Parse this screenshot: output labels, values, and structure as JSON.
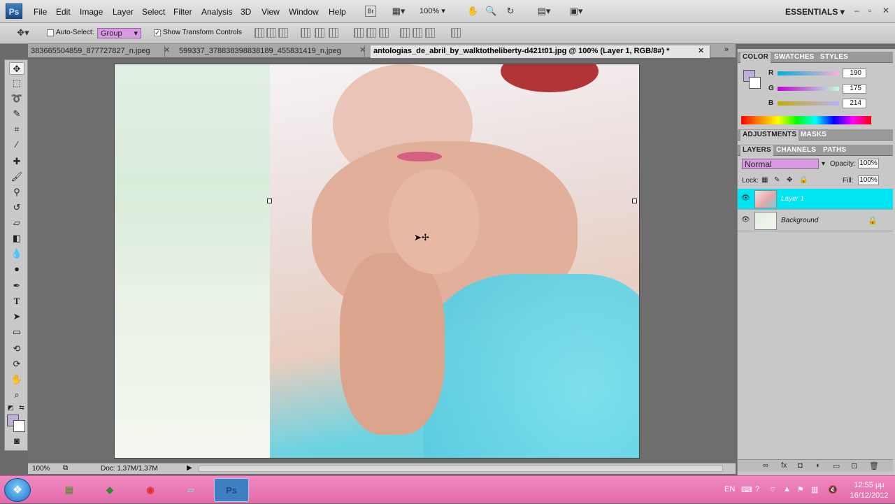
{
  "menubar": {
    "logo": "Ps",
    "items": [
      "File",
      "Edit",
      "Image",
      "Layer",
      "Select",
      "Filter",
      "Analysis",
      "3D",
      "View",
      "Window",
      "Help"
    ],
    "zoom": "100%",
    "workspace": "ESSENTIALS"
  },
  "options": {
    "auto_select_label": "Auto-Select:",
    "auto_select_value": "Group",
    "show_transform_label": "Show Transform Controls"
  },
  "tabs": [
    {
      "label": "383665504859_877727827_n.jpeg",
      "active": false
    },
    {
      "label": "599337_378838398838189_455831419_n.jpeg",
      "active": false
    },
    {
      "label": "antologias_de_abril_by_walktotheliberty-d421t01.jpg @ 100% (Layer 1, RGB/8#) *",
      "active": true
    }
  ],
  "status": {
    "zoom": "100%",
    "doc": "Doc: 1,37M/1,37M"
  },
  "color_panel": {
    "tabs": [
      "COLOR",
      "SWATCHES",
      "STYLES"
    ],
    "channels": [
      {
        "label": "R",
        "value": "190"
      },
      {
        "label": "G",
        "value": "175"
      },
      {
        "label": "B",
        "value": "214"
      }
    ],
    "foreground": "#beafd6",
    "background": "#ffffff"
  },
  "adjust_panel": {
    "tabs": [
      "ADJUSTMENTS",
      "MASKS"
    ]
  },
  "layers_panel": {
    "tabs": [
      "LAYERS",
      "CHANNELS",
      "PATHS"
    ],
    "blend_mode": "Normal",
    "opacity_label": "Opacity:",
    "opacity": "100%",
    "lock_label": "Lock:",
    "fill_label": "Fill:",
    "fill": "100%",
    "layers": [
      {
        "name": "Layer 1",
        "selected": true
      },
      {
        "name": "Background",
        "selected": false,
        "locked": true
      }
    ]
  },
  "taskbar": {
    "lang": "EN",
    "time": "12:55 μμ",
    "date": "16/12/2012"
  }
}
